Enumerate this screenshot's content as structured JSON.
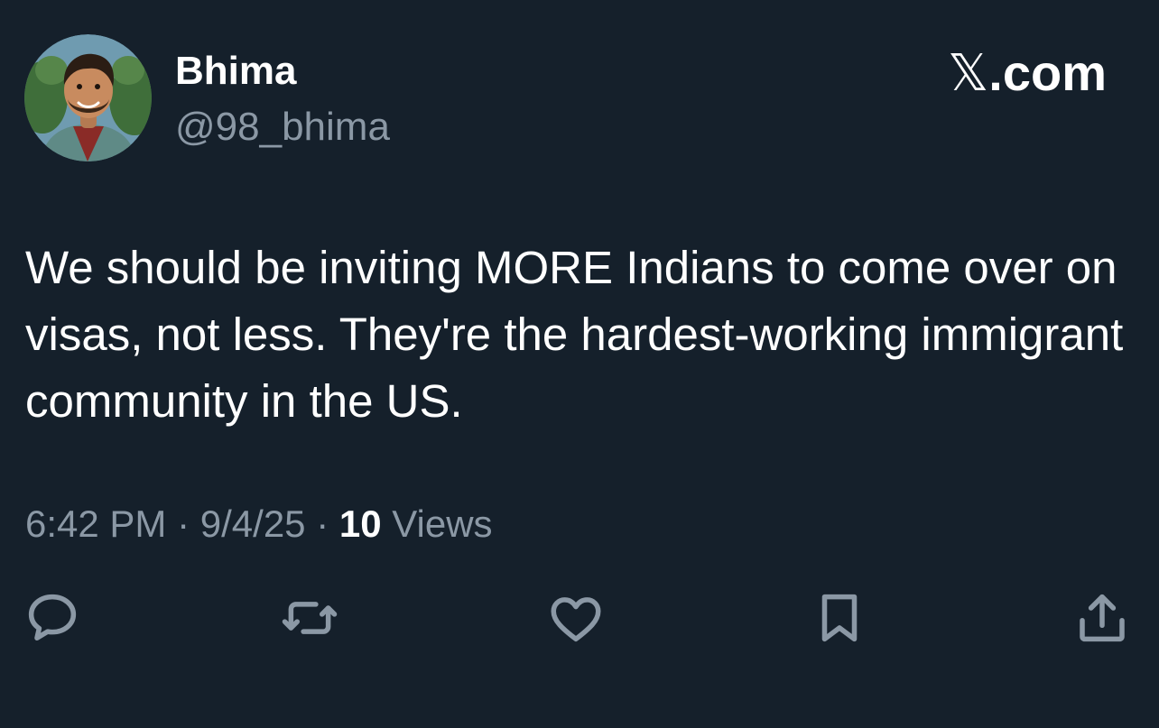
{
  "tweet": {
    "author": {
      "display_name": "Bhima",
      "handle": "@98_bhima"
    },
    "brand": {
      "glyph": "𝕏",
      "suffix": ".com"
    },
    "text": "We should be inviting MORE Indians to come over on visas, not less. They're the hardest-working immigrant community in the US.",
    "time": "6:42 PM",
    "date": "9/4/25",
    "separator": "·",
    "views_count": "10",
    "views_label": "Views"
  },
  "actions": [
    {
      "name": "reply",
      "icon": "speech-bubble-icon"
    },
    {
      "name": "repost",
      "icon": "repost-arrows-icon"
    },
    {
      "name": "like",
      "icon": "heart-icon"
    },
    {
      "name": "bookmark",
      "icon": "bookmark-icon"
    },
    {
      "name": "share",
      "icon": "share-upload-icon"
    }
  ],
  "colors": {
    "background": "#15202b",
    "text_primary": "#ffffff",
    "text_secondary": "#8b98a5"
  }
}
